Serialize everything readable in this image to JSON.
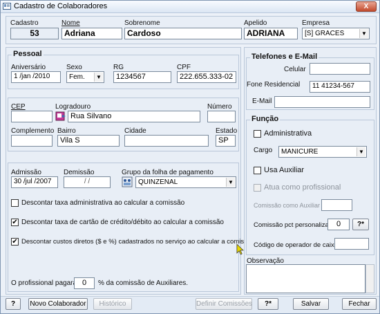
{
  "window": {
    "title": "Cadastro de Colaboradores",
    "close_glyph": "X"
  },
  "header": {
    "cadastro_label": "Cadastro",
    "cadastro_value": "53",
    "nome_label": "Nome",
    "nome_value": "Adriana",
    "sobrenome_label": "Sobrenome",
    "sobrenome_value": "Cardoso",
    "apelido_label": "Apelido",
    "apelido_value": "ADRIANA",
    "empresa_label": "Empresa",
    "empresa_value": "[S] GRACES"
  },
  "pessoal": {
    "title": "Pessoal",
    "aniversario_label": "Aniversário",
    "aniversario_value": "1  /jan  /2010",
    "sexo_label": "Sexo",
    "sexo_value": "Fem.",
    "rg_label": "RG",
    "rg_value": "1234567",
    "cpf_label": "CPF",
    "cpf_value": "222.655.333-02"
  },
  "endereco": {
    "cep_label": "CEP",
    "cep_value": "",
    "logradouro_label": "Logradouro",
    "logradouro_value": "Rua Silvano",
    "numero_label": "Número",
    "numero_value": "",
    "complemento_label": "Complemento",
    "complemento_value": "",
    "bairro_label": "Bairro",
    "bairro_value": "Vila S",
    "cidade_label": "Cidade",
    "cidade_value": "",
    "estado_label": "Estado",
    "estado_value": "SP"
  },
  "contrato": {
    "admissao_label": "Admissão",
    "admissao_value": "30 /jul  /2007",
    "demissao_label": "Demissão",
    "demissao_value": "/    /",
    "grupo_label": "Grupo da folha de pagamento",
    "grupo_value": "QUINZENAL",
    "chk1_label": "Descontar taxa administrativa ao calcular a comissão",
    "chk1": false,
    "chk2_label": "Descontar taxa de cartão de crédito/débito ao calcular a comissão",
    "chk2": true,
    "chk3_label": "Descontar custos diretos ($ e %) cadastrados no serviço ao calcular a comissão",
    "chk3": true,
    "pagara_label": "O profissional pagará",
    "pagara_value": "0",
    "pagara_suffix": "% da comissão de Auxiliares."
  },
  "telefones": {
    "title": "Telefones e E-Mail",
    "celular_label": "Celular",
    "celular_value": "",
    "fone_label": "Fone Residencial",
    "fone_value": "11 41234-567",
    "email_label": "E-Mail",
    "email_value": ""
  },
  "funcao": {
    "title": "Função",
    "administrativa_label": "Administrativa",
    "cargo_label": "Cargo",
    "cargo_value": "MANICURE",
    "usa_auxiliar_label": "Usa Auxiliar",
    "atua_label": "Atua como profissional",
    "comissao_aux_label": "Comissão como Auxiliar",
    "comissao_aux_value": "",
    "comissao_pct_label": "Comissão pct personalizado",
    "comissao_pct_value": "0",
    "help_small": "?*",
    "codigo_label": "Código de operador de caixa",
    "codigo_value": ""
  },
  "observacao": {
    "label": "Observação",
    "value": ""
  },
  "footer": {
    "help": "?",
    "novo": "Novo Colaborador",
    "historico": "Histórico",
    "definir": "Definir Comissões",
    "help2": "?*",
    "salvar": "Salvar",
    "fechar": "Fechar"
  }
}
